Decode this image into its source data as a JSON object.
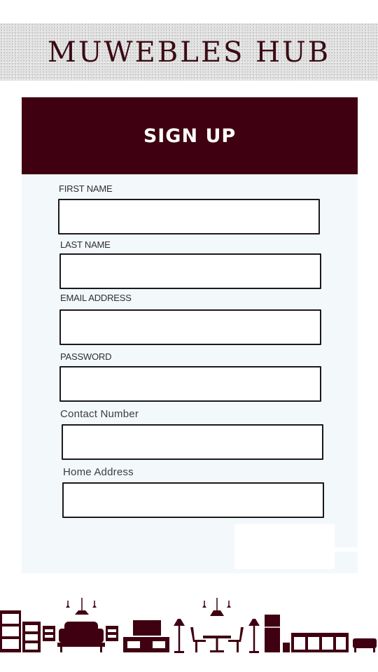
{
  "brand": {
    "title": "MUWEBLES HUB"
  },
  "form": {
    "title": "SIGN UP",
    "fields": [
      {
        "label": "FIRST NAME",
        "value": ""
      },
      {
        "label": "LAST NAME",
        "value": ""
      },
      {
        "label": "EMAIL ADDRESS",
        "value": ""
      },
      {
        "label": "PASSWORD",
        "value": ""
      },
      {
        "label": "Contact Number",
        "value": ""
      },
      {
        "label": "Home Address",
        "value": ""
      }
    ]
  },
  "colors": {
    "primary": "#3f0011",
    "card_background": "#f3f8fb",
    "brand_text": "#3a0b14",
    "brand_bar": "#e1e1e1",
    "furniture": "#3f0011"
  },
  "icons": [
    "furniture-silhouette-icon"
  ]
}
